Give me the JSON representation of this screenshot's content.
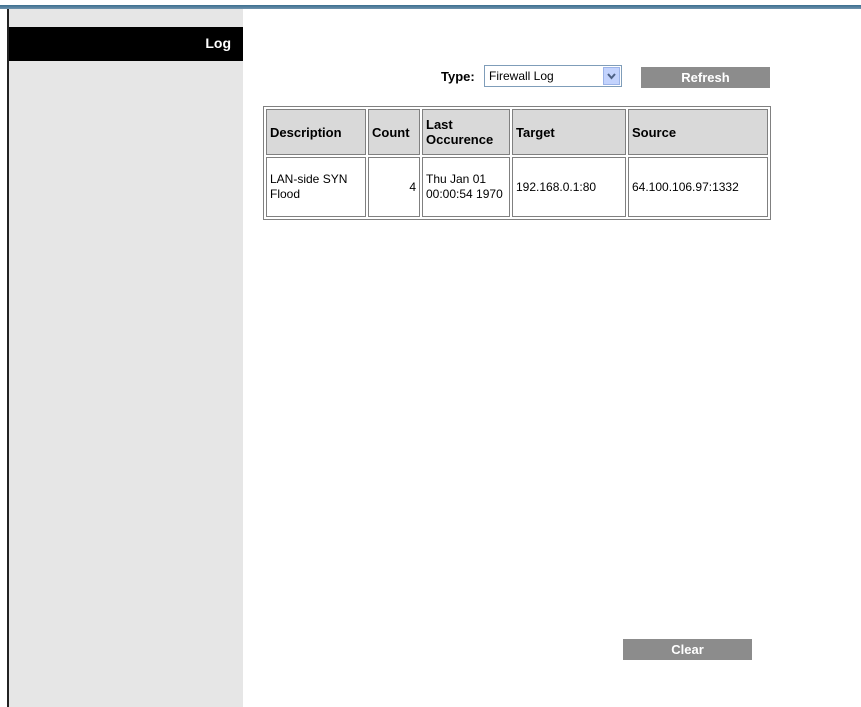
{
  "sidebar": {
    "title": "Log"
  },
  "filter": {
    "type_label": "Type:",
    "type_selected": "Firewall Log",
    "refresh_label": "Refresh"
  },
  "table": {
    "headers": [
      "Description",
      "Count",
      "Last Occurence",
      "Target",
      "Source"
    ],
    "rows": [
      {
        "description": "LAN-side SYN Flood",
        "count": "4",
        "last_occurence": "Thu Jan 01 00:00:54 1970",
        "target": "192.168.0.1:80",
        "source": "64.100.106.97:1332"
      }
    ]
  },
  "actions": {
    "clear_label": "Clear"
  },
  "icons": {
    "dropdown": "chevron-down-icon"
  },
  "colors": {
    "sidebar_header_bg": "#000000",
    "sidebar_bg": "#e6e6e6",
    "button_bg": "#8c8c8c",
    "header_cell_bg": "#d9d9d9"
  }
}
